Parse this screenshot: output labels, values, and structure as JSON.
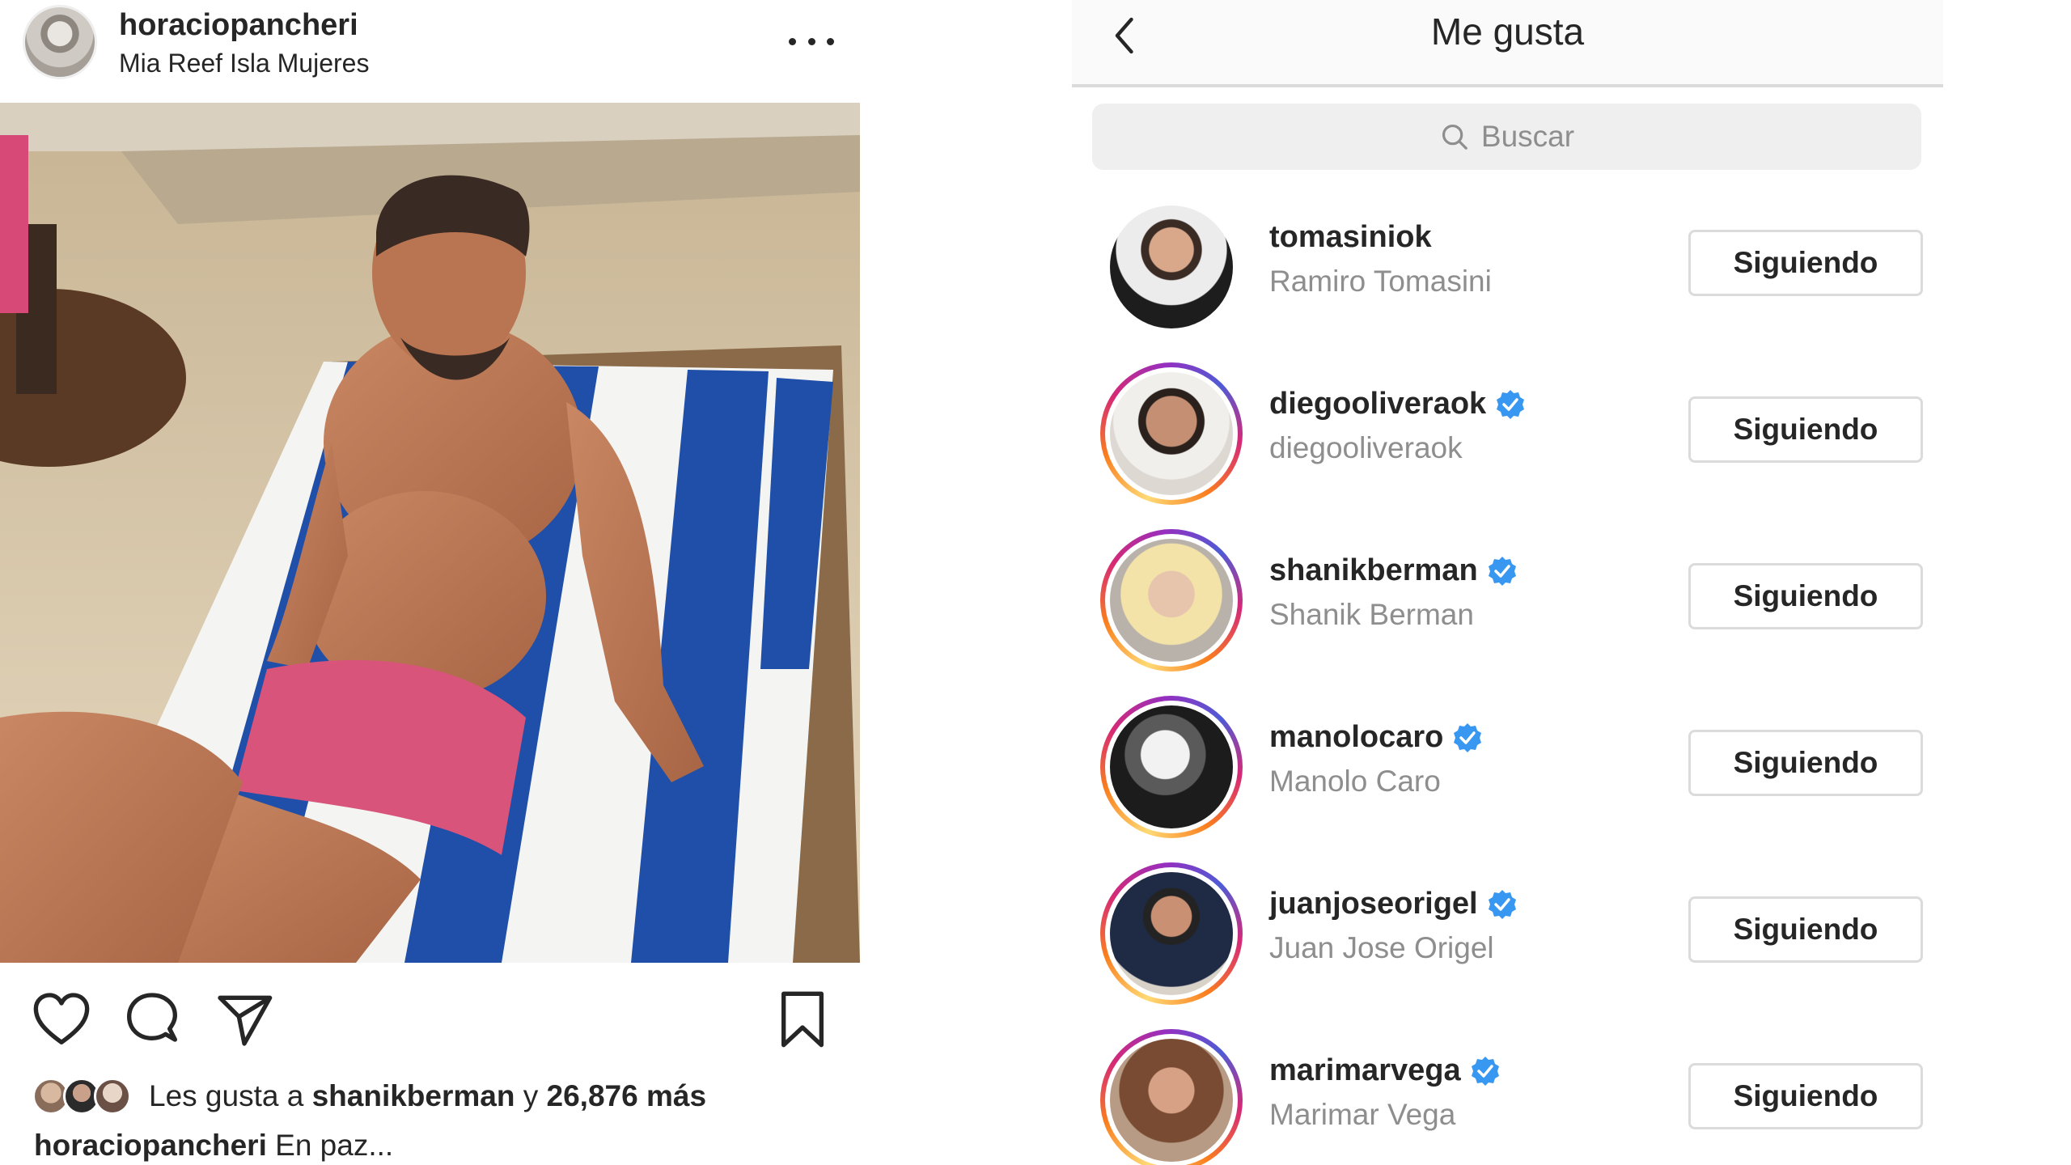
{
  "post": {
    "username": "horaciopancheri",
    "location": "Mia Reef Isla Mujeres",
    "more_icon": "more-horizontal-icon",
    "actions": {
      "like_icon": "heart-icon",
      "comment_icon": "comment-icon",
      "share_icon": "send-icon",
      "save_icon": "bookmark-icon"
    },
    "likes": {
      "prefix": "Les gusta a ",
      "user": "shanikberman",
      "connector": " y ",
      "count": "26,876 más"
    },
    "caption": {
      "username": "horaciopancheri",
      "text": " En paz..."
    }
  },
  "likes_panel": {
    "title": "Me gusta",
    "back_icon": "chevron-left-icon",
    "search": {
      "icon": "search-icon",
      "placeholder": "Buscar"
    },
    "users": [
      {
        "handle": "tomasiniok",
        "full_name": "Ramiro Tomasini",
        "verified": false,
        "story_ring": false,
        "button": "Siguiendo"
      },
      {
        "handle": "diegooliveraok",
        "full_name": "diegooliveraok",
        "verified": true,
        "story_ring": true,
        "button": "Siguiendo"
      },
      {
        "handle": "shanikberman",
        "full_name": "Shanik Berman",
        "verified": true,
        "story_ring": true,
        "button": "Siguiendo"
      },
      {
        "handle": "manolocaro",
        "full_name": "Manolo Caro",
        "verified": true,
        "story_ring": true,
        "button": "Siguiendo"
      },
      {
        "handle": "juanjoseorigel",
        "full_name": "Juan Jose Origel",
        "verified": true,
        "story_ring": true,
        "button": "Siguiendo"
      },
      {
        "handle": "marimarvega",
        "full_name": "Marimar Vega",
        "verified": true,
        "story_ring": true,
        "button": "Siguiendo"
      }
    ]
  },
  "colors": {
    "text_primary": "#262626",
    "text_secondary": "#8e8e8e",
    "verified_blue": "#3897f0",
    "border": "#dbdbdb",
    "towel_blue": "#1f4fa8"
  }
}
